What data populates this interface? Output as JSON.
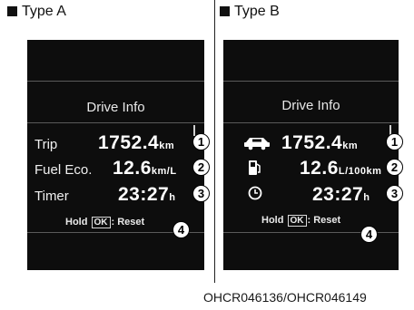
{
  "type_a": {
    "label": "Type A",
    "title": "Drive Info",
    "rows": [
      {
        "label": "Trip",
        "value": "1752.4",
        "unit": "km",
        "callout": "1"
      },
      {
        "label": "Fuel Eco.",
        "value": "12.6",
        "unit": "km/L",
        "callout": "2"
      },
      {
        "label": "Timer",
        "value": "23:27",
        "unit": "h",
        "callout": "3"
      }
    ],
    "hold": {
      "prefix": "Hold",
      "key": "OK",
      "suffix": ": Reset",
      "callout": "4"
    }
  },
  "type_b": {
    "label": "Type B",
    "title": "Drive Info",
    "rows": [
      {
        "icon": "car-icon",
        "value": "1752.4",
        "unit": "km",
        "callout": "1"
      },
      {
        "icon": "fuel-pump-icon",
        "value": "12.6",
        "unit": "L/100km",
        "callout": "2"
      },
      {
        "icon": "clock-icon",
        "value": "23:27",
        "unit": "h",
        "callout": "3"
      }
    ],
    "hold": {
      "prefix": "Hold",
      "key": "OK",
      "suffix": ": Reset",
      "callout": "4"
    }
  },
  "caption": "OHCR046136/OHCR046149",
  "colors": {
    "panel": "#0d0d0d",
    "text": "#ffffff",
    "background": "#ffffff"
  }
}
